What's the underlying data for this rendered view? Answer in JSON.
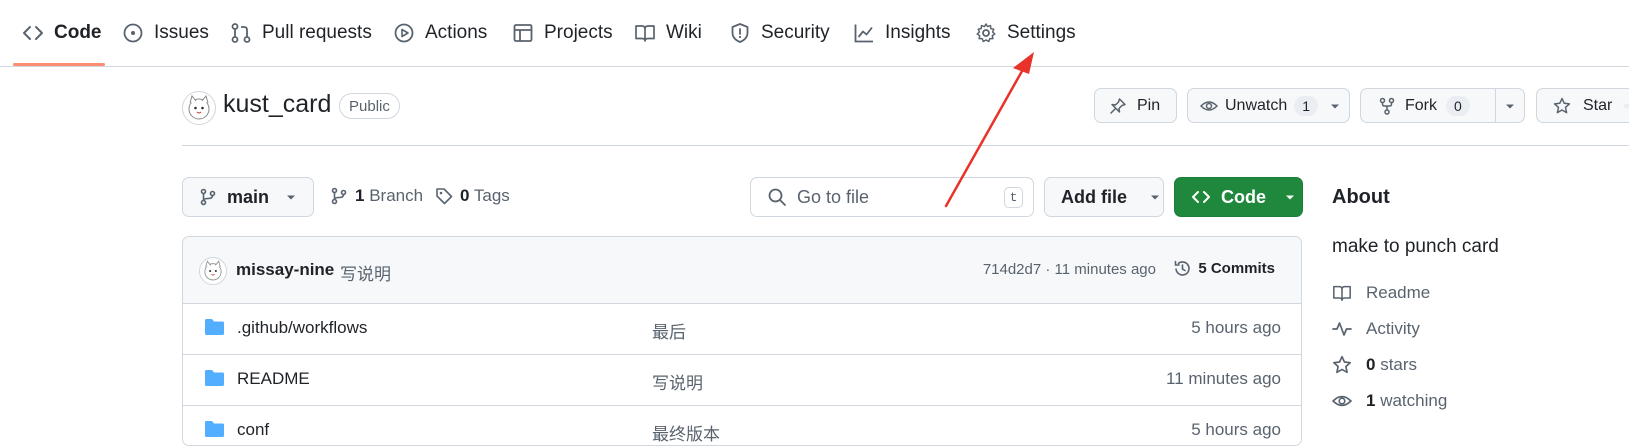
{
  "nav": {
    "tabs": [
      {
        "label": "Code",
        "icon": "code-icon",
        "active": true
      },
      {
        "label": "Issues",
        "icon": "issue-opened-icon"
      },
      {
        "label": "Pull requests",
        "icon": "git-pull-request-icon"
      },
      {
        "label": "Actions",
        "icon": "play-icon"
      },
      {
        "label": "Projects",
        "icon": "table-icon"
      },
      {
        "label": "Wiki",
        "icon": "book-icon"
      },
      {
        "label": "Security",
        "icon": "shield-icon"
      },
      {
        "label": "Insights",
        "icon": "graph-icon"
      },
      {
        "label": "Settings",
        "icon": "gear-icon"
      }
    ],
    "active_underline_color": "#fd8c73"
  },
  "repo": {
    "name": "kust_card",
    "visibility": "Public",
    "actions": {
      "pin_label": "Pin",
      "unwatch_label": "Unwatch",
      "watch_count": "1",
      "fork_label": "Fork",
      "fork_count": "0",
      "star_label": "Star"
    }
  },
  "branch_bar": {
    "branch": "main",
    "branches_count": "1",
    "branches_label": "Branch",
    "tags_count": "0",
    "tags_label": "Tags",
    "search_placeholder": "Go to file",
    "search_shortcut": "t",
    "add_file_label": "Add file",
    "code_label": "Code",
    "code_button_color": "#1f883d"
  },
  "latest_commit": {
    "author": "missay-nine",
    "message": "写说明",
    "hash_time": "714d2d7 · 11 minutes ago",
    "commits_label": "5 Commits"
  },
  "files": [
    {
      "name": ".github/workflows",
      "message": "最后",
      "time": "5 hours ago"
    },
    {
      "name": "README",
      "message": "写说明",
      "time": "11 minutes ago"
    },
    {
      "name": "conf",
      "message": "最终版本",
      "time": "5 hours ago"
    }
  ],
  "about": {
    "title": "About",
    "description": "make to punch card",
    "readme_label": "Readme",
    "activity_label": "Activity",
    "stars_count": "0",
    "stars_label": "stars",
    "watching_count": "1",
    "watching_label": "watching"
  },
  "annotation": {
    "color": "#e8322a"
  },
  "colors": {
    "border": "#d0d7de",
    "muted": "#59636e",
    "folder": "#54aeff",
    "accent_orange": "#fd8c73"
  }
}
